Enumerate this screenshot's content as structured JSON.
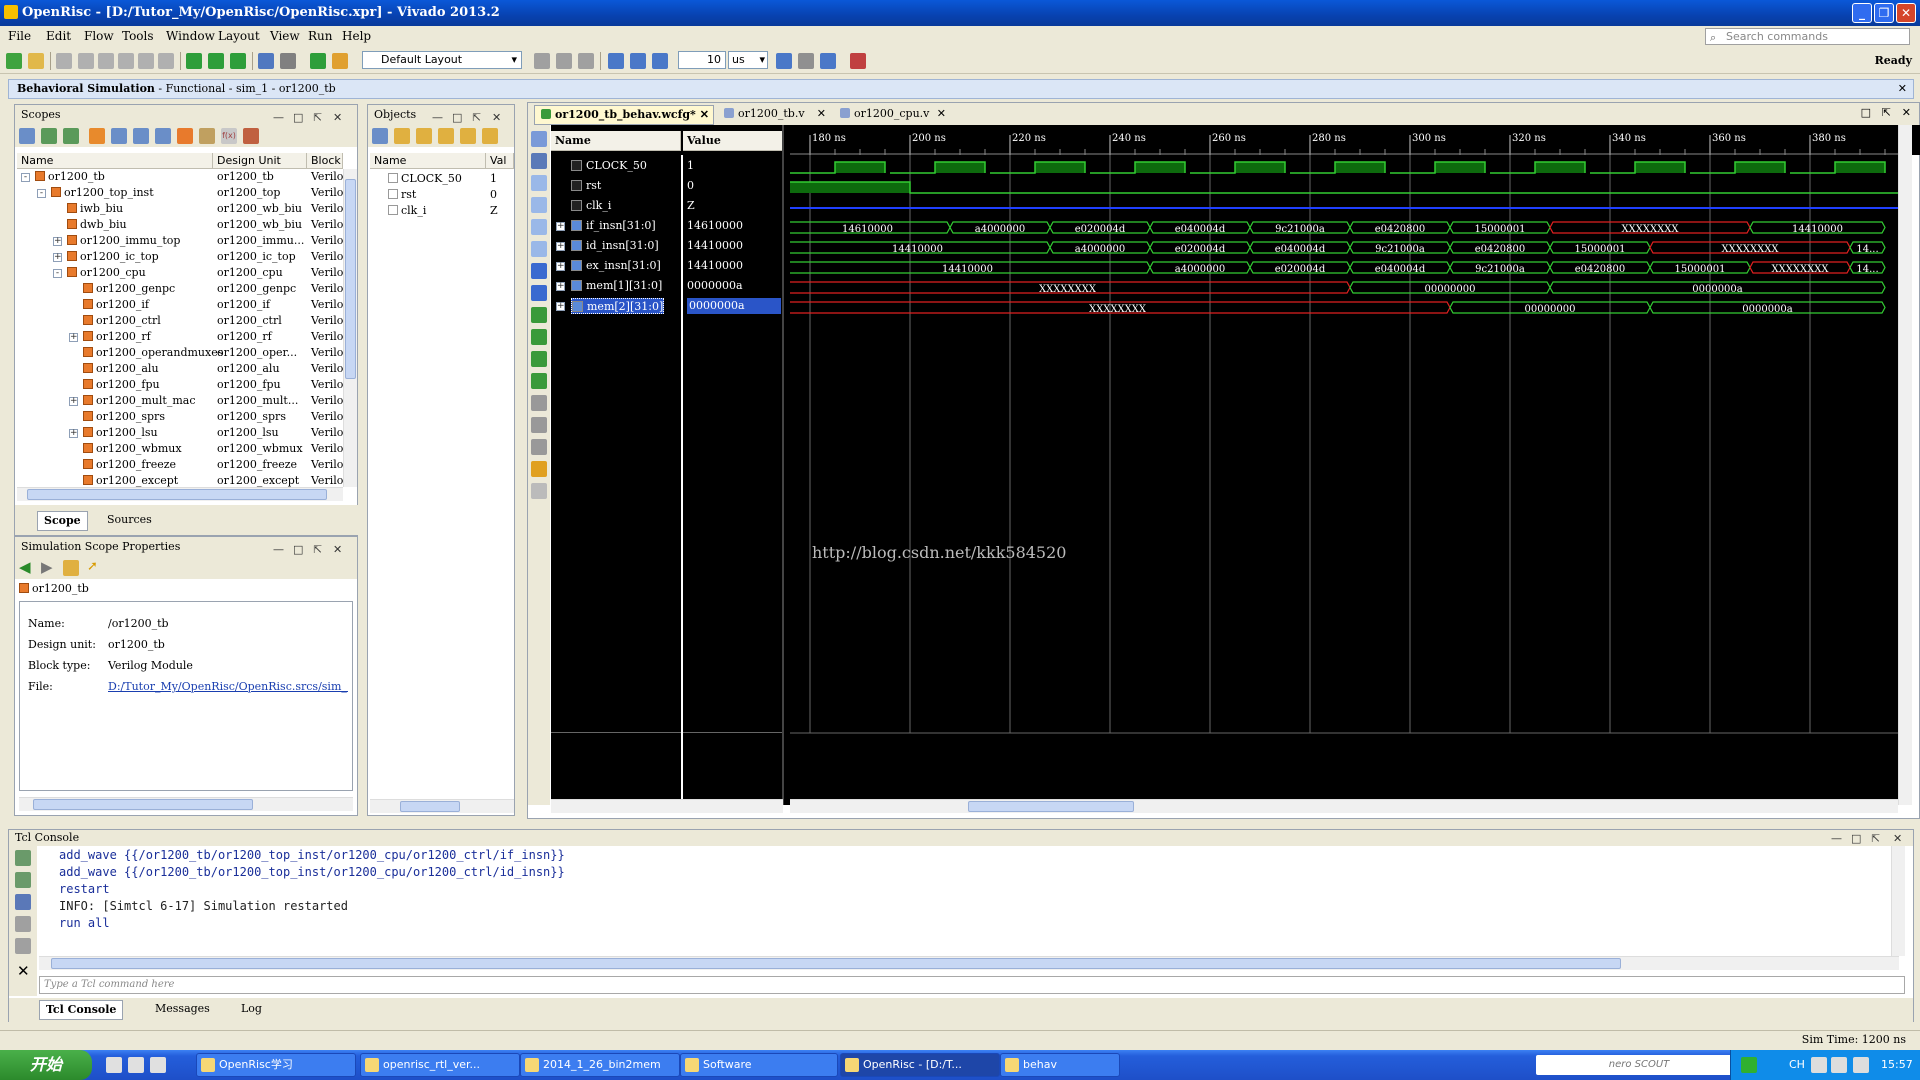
{
  "window": {
    "title": "OpenRisc - [D:/Tutor_My/OpenRisc/OpenRisc.xpr] - Vivado 2013.2",
    "min": "_",
    "max": "❐",
    "close": "✕"
  },
  "menu": [
    "File",
    "Edit",
    "Flow",
    "Tools",
    "Window",
    "Layout",
    "View",
    "Run",
    "Help"
  ],
  "search_placeholder": "Search commands",
  "toolbar": {
    "layout": "Default Layout",
    "zoom_value": "10",
    "zoom_unit": "us",
    "status": "Ready"
  },
  "flow_header": {
    "main": "Behavioral Simulation",
    "sub": " - Functional - sim_1 - or1200_tb"
  },
  "scopes": {
    "title": "Scopes",
    "headers": [
      "Name",
      "Design Unit",
      "Block"
    ],
    "rows": [
      {
        "name": "or1200_tb",
        "unit": "or1200_tb",
        "block": "Verilo",
        "indent": 0,
        "exp": "-"
      },
      {
        "name": "or1200_top_inst",
        "unit": "or1200_top",
        "block": "Verilo",
        "indent": 1,
        "exp": "-"
      },
      {
        "name": "iwb_biu",
        "unit": "or1200_wb_biu",
        "block": "Verilo",
        "indent": 2,
        "exp": ""
      },
      {
        "name": "dwb_biu",
        "unit": "or1200_wb_biu",
        "block": "Verilo",
        "indent": 2,
        "exp": ""
      },
      {
        "name": "or1200_immu_top",
        "unit": "or1200_immu...",
        "block": "Verilo",
        "indent": 2,
        "exp": "+"
      },
      {
        "name": "or1200_ic_top",
        "unit": "or1200_ic_top",
        "block": "Verilo",
        "indent": 2,
        "exp": "+"
      },
      {
        "name": "or1200_cpu",
        "unit": "or1200_cpu",
        "block": "Verilo",
        "indent": 2,
        "exp": "-"
      },
      {
        "name": "or1200_genpc",
        "unit": "or1200_genpc",
        "block": "Verilo",
        "indent": 3,
        "exp": ""
      },
      {
        "name": "or1200_if",
        "unit": "or1200_if",
        "block": "Verilo",
        "indent": 3,
        "exp": ""
      },
      {
        "name": "or1200_ctrl",
        "unit": "or1200_ctrl",
        "block": "Verilo",
        "indent": 3,
        "exp": ""
      },
      {
        "name": "or1200_rf",
        "unit": "or1200_rf",
        "block": "Verilo",
        "indent": 3,
        "exp": "+"
      },
      {
        "name": "or1200_operandmuxes",
        "unit": "or1200_oper...",
        "block": "Verilo",
        "indent": 3,
        "exp": ""
      },
      {
        "name": "or1200_alu",
        "unit": "or1200_alu",
        "block": "Verilo",
        "indent": 3,
        "exp": ""
      },
      {
        "name": "or1200_fpu",
        "unit": "or1200_fpu",
        "block": "Verilo",
        "indent": 3,
        "exp": ""
      },
      {
        "name": "or1200_mult_mac",
        "unit": "or1200_mult...",
        "block": "Verilo",
        "indent": 3,
        "exp": "+"
      },
      {
        "name": "or1200_sprs",
        "unit": "or1200_sprs",
        "block": "Verilo",
        "indent": 3,
        "exp": ""
      },
      {
        "name": "or1200_lsu",
        "unit": "or1200_lsu",
        "block": "Verilo",
        "indent": 3,
        "exp": "+"
      },
      {
        "name": "or1200_wbmux",
        "unit": "or1200_wbmux",
        "block": "Verilo",
        "indent": 3,
        "exp": ""
      },
      {
        "name": "or1200_freeze",
        "unit": "or1200_freeze",
        "block": "Verilo",
        "indent": 3,
        "exp": ""
      },
      {
        "name": "or1200_except",
        "unit": "or1200_except",
        "block": "Verilo",
        "indent": 3,
        "exp": ""
      }
    ],
    "tabs": [
      "Scope",
      "Sources"
    ]
  },
  "objects": {
    "title": "Objects",
    "headers": [
      "Name",
      "Val"
    ],
    "rows": [
      {
        "name": "CLOCK_50",
        "val": "1"
      },
      {
        "name": "rst",
        "val": "0"
      },
      {
        "name": "clk_i",
        "val": "Z"
      }
    ]
  },
  "props": {
    "title": "Simulation Scope Properties",
    "scope": "or1200_tb",
    "fields": [
      {
        "k": "Name:",
        "v": "/or1200_tb"
      },
      {
        "k": "Design unit:",
        "v": "or1200_tb"
      },
      {
        "k": "Block type:",
        "v": "Verilog Module"
      },
      {
        "k": "File:",
        "v": "D:/Tutor_My/OpenRisc/OpenRisc.srcs/sim_1/"
      }
    ]
  },
  "editor_tabs": [
    {
      "label": "or1200_tb_behav.wcfg*",
      "active": true
    },
    {
      "label": "or1200_tb.v",
      "active": false
    },
    {
      "label": "or1200_cpu.v",
      "active": false
    }
  ],
  "wave": {
    "col_name": "Name",
    "col_value": "Value",
    "watermark": "http://blog.csdn.net/kkk584520",
    "ticks": [
      "180 ns",
      "200 ns",
      "220 ns",
      "240 ns",
      "260 ns",
      "280 ns",
      "300 ns",
      "320 ns",
      "340 ns",
      "360 ns",
      "380 ns"
    ],
    "signals": [
      {
        "name": "CLOCK_50",
        "value": "1",
        "bus": false
      },
      {
        "name": "rst",
        "value": "0",
        "bus": false
      },
      {
        "name": "clk_i",
        "value": "Z",
        "bus": false
      },
      {
        "name": "if_insn[31:0]",
        "value": "14610000",
        "bus": true
      },
      {
        "name": "id_insn[31:0]",
        "value": "14410000",
        "bus": true
      },
      {
        "name": "ex_insn[31:0]",
        "value": "14410000",
        "bus": true
      },
      {
        "name": "mem[1][31:0]",
        "value": "0000000a",
        "bus": true
      },
      {
        "name": "mem[2][31:0]",
        "value": "0000000a",
        "bus": true,
        "selected": true
      }
    ],
    "bus_segments": [
      [
        {
          "ns": 175,
          "end": 208,
          "v": "14610000",
          "c": "g"
        },
        {
          "ns": 208,
          "end": 228,
          "v": "a4000000",
          "c": "g"
        },
        {
          "ns": 228,
          "end": 248,
          "v": "e020004d",
          "c": "g"
        },
        {
          "ns": 248,
          "end": 268,
          "v": "e040004d",
          "c": "g"
        },
        {
          "ns": 268,
          "end": 288,
          "v": "9c21000a",
          "c": "g"
        },
        {
          "ns": 288,
          "end": 308,
          "v": "e0420800",
          "c": "g"
        },
        {
          "ns": 308,
          "end": 328,
          "v": "15000001",
          "c": "g"
        },
        {
          "ns": 328,
          "end": 368,
          "v": "XXXXXXXX",
          "c": "r"
        },
        {
          "ns": 368,
          "end": 395,
          "v": "14410000",
          "c": "g"
        }
      ],
      [
        {
          "ns": 175,
          "end": 228,
          "v": "14410000",
          "c": "g"
        },
        {
          "ns": 228,
          "end": 248,
          "v": "a4000000",
          "c": "g"
        },
        {
          "ns": 248,
          "end": 268,
          "v": "e020004d",
          "c": "g"
        },
        {
          "ns": 268,
          "end": 288,
          "v": "e040004d",
          "c": "g"
        },
        {
          "ns": 288,
          "end": 308,
          "v": "9c21000a",
          "c": "g"
        },
        {
          "ns": 308,
          "end": 328,
          "v": "e0420800",
          "c": "g"
        },
        {
          "ns": 328,
          "end": 348,
          "v": "15000001",
          "c": "g"
        },
        {
          "ns": 348,
          "end": 388,
          "v": "XXXXXXXX",
          "c": "r"
        },
        {
          "ns": 388,
          "end": 395,
          "v": "14...",
          "c": "g"
        }
      ],
      [
        {
          "ns": 175,
          "end": 248,
          "v": "14410000",
          "c": "g"
        },
        {
          "ns": 248,
          "end": 268,
          "v": "a4000000",
          "c": "g"
        },
        {
          "ns": 268,
          "end": 288,
          "v": "e020004d",
          "c": "g"
        },
        {
          "ns": 288,
          "end": 308,
          "v": "e040004d",
          "c": "g"
        },
        {
          "ns": 308,
          "end": 328,
          "v": "9c21000a",
          "c": "g"
        },
        {
          "ns": 328,
          "end": 348,
          "v": "e0420800",
          "c": "g"
        },
        {
          "ns": 348,
          "end": 368,
          "v": "15000001",
          "c": "g"
        },
        {
          "ns": 368,
          "end": 388,
          "v": "XXXXXXXX",
          "c": "r"
        },
        {
          "ns": 388,
          "end": 395,
          "v": "14...",
          "c": "g"
        }
      ],
      [
        {
          "ns": 175,
          "end": 288,
          "v": "XXXXXXXX",
          "c": "r"
        },
        {
          "ns": 288,
          "end": 328,
          "v": "00000000",
          "c": "g"
        },
        {
          "ns": 328,
          "end": 395,
          "v": "0000000a",
          "c": "g"
        }
      ],
      [
        {
          "ns": 175,
          "end": 308,
          "v": "XXXXXXXX",
          "c": "r"
        },
        {
          "ns": 308,
          "end": 348,
          "v": "00000000",
          "c": "g"
        },
        {
          "ns": 348,
          "end": 395,
          "v": "0000000a",
          "c": "g"
        }
      ]
    ]
  },
  "tcl": {
    "title": "Tcl Console",
    "lines": [
      "add_wave {{/or1200_tb/or1200_top_inst/or1200_cpu/or1200_ctrl/if_insn}}",
      "add_wave {{/or1200_tb/or1200_top_inst/or1200_cpu/or1200_ctrl/id_insn}}",
      "restart",
      "INFO: [Simtcl 6-17] Simulation restarted",
      "run all"
    ],
    "input_placeholder": "Type a Tcl command here",
    "tabs": [
      "Tcl Console",
      "Messages",
      "Log"
    ]
  },
  "status": {
    "simtime": "Sim Time: 1200 ns"
  },
  "taskbar": {
    "start": "开始",
    "tasks": [
      "OpenRisc学习",
      "openrisc_rtl_ver...",
      "2014_1_26_bin2mem",
      "Software",
      "OpenRisc - [D:/T...",
      "behav"
    ],
    "tray_lang": "CH",
    "clock": "15:57",
    "nero": "nero SCOUT"
  }
}
